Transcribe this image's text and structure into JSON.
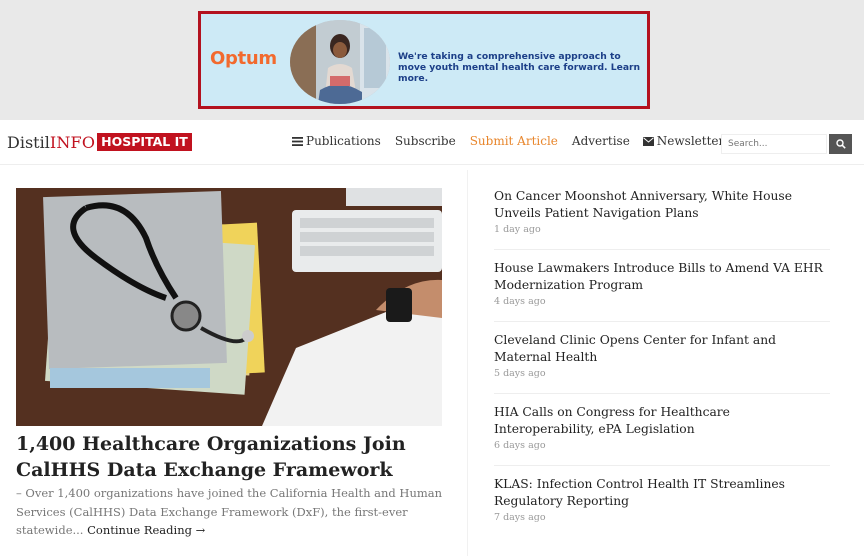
{
  "ad": {
    "brand": "Optum",
    "message": "We're taking a comprehensive approach to move youth mental health care forward. Learn more.",
    "brand_color": "#f26a2e",
    "border_color": "#b3121f",
    "background_color": "#cdeaf6"
  },
  "header": {
    "logo_distil": "Distil",
    "logo_info": "INFO",
    "logo_tag": "HOSPITAL IT",
    "brand_red": "#c1121f",
    "nav": [
      {
        "label": "Publications",
        "icon": "hamburger-menu-icon"
      },
      {
        "label": "Subscribe"
      },
      {
        "label": "Submit Article",
        "active": true
      },
      {
        "label": "Advertise"
      },
      {
        "label": "Newsletters",
        "icon": "envelope-icon"
      }
    ],
    "accent_color": "#e8862c",
    "search": {
      "placeholder": "Search...",
      "value": "",
      "icon": "search-icon"
    }
  },
  "feature": {
    "image_description_icon": "stethoscope-desk-photo",
    "title": "1,400 Healthcare Organizations Join CalHHS Data Exchange Framework",
    "excerpt": "– Over 1,400 organizations have joined the California Health and Human Services (CalHHS) Data Exchange Framework (DxF), the first-ever statewide...",
    "more_label": "Continue Reading →"
  },
  "sidebar": {
    "stories": [
      {
        "title": "On Cancer Moonshot Anniversary, White House Unveils Patient Navigation Plans",
        "date": "1 day ago"
      },
      {
        "title": "House Lawmakers Introduce Bills to Amend VA EHR Modernization Program",
        "date": "4 days ago"
      },
      {
        "title": "Cleveland Clinic Opens Center for Infant and Maternal Health",
        "date": "5 days ago"
      },
      {
        "title": "HIA Calls on Congress for Healthcare Interoperability, ePA Legislation",
        "date": "6 days ago"
      },
      {
        "title": "KLAS: Infection Control Health IT Streamlines Regulatory Reporting",
        "date": "7 days ago"
      }
    ]
  }
}
